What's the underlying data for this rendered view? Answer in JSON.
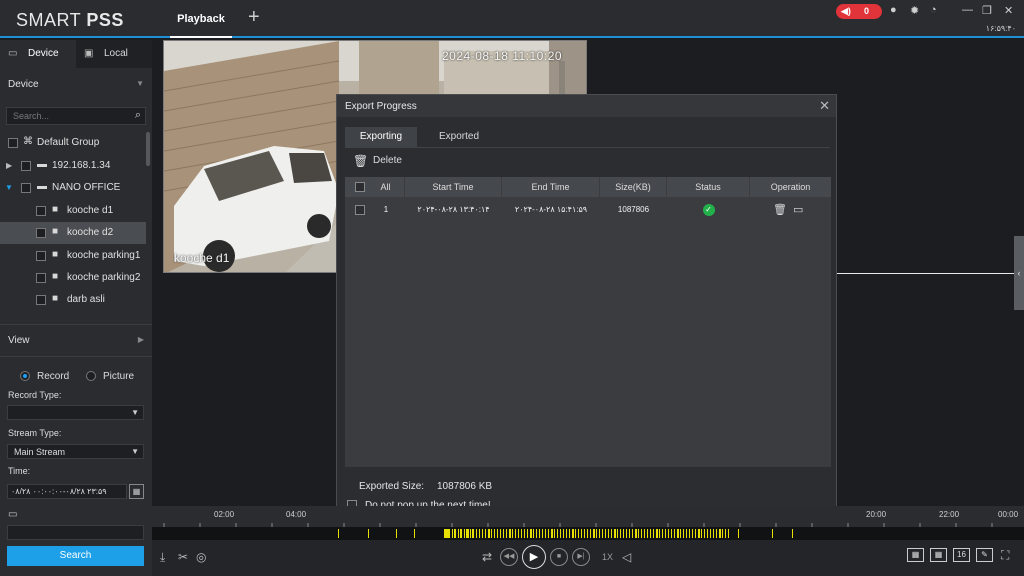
{
  "app": {
    "logo_light": "SMART ",
    "logo_bold": "PSS",
    "active_tab": "Playback",
    "add_tab": "+"
  },
  "titlebar": {
    "alarm_count": "0",
    "clock": "۱۶:۵۹:۴۰"
  },
  "left": {
    "tab_device": "Device",
    "tab_local": "Local",
    "device_section": "Device",
    "search_placeholder": "Search...",
    "tree": [
      {
        "label": "Default Group"
      },
      {
        "label": "192.168.1.34"
      },
      {
        "label": "NANO OFFICE"
      },
      {
        "label": "kooche d1"
      },
      {
        "label": "kooche d2"
      },
      {
        "label": "kooche parking1"
      },
      {
        "label": "kooche parking2"
      },
      {
        "label": "darb asli"
      }
    ],
    "view_section": "View",
    "radio_record": "Record",
    "radio_picture": "Picture",
    "record_type_label": "Record Type:",
    "record_type_value": "",
    "stream_type_label": "Stream Type:",
    "stream_type_value": "Main Stream",
    "time_label": "Time:",
    "time_value": "۰۸/۲۸ ۰۰:۰۰:۰۰-۰۸/۲۸ ۲۳:۵۹",
    "search_button": "Search"
  },
  "video": {
    "osd_time": "2024-08-18 11:10:20",
    "osd_name": "kooche d1"
  },
  "dialog": {
    "title": "Export Progress",
    "tab_exporting": "Exporting",
    "tab_exported": "Exported",
    "delete_label": "Delete",
    "columns": [
      "All",
      "Start Time",
      "End Time",
      "Size(KB)",
      "Status",
      "Operation"
    ],
    "rows": [
      {
        "index": "1",
        "start": "۲۰۲۴-۰۸-۲۸ ۱۳:۴۰:۱۴",
        "end": "۲۰۲۴-۰۸-۲۸ ۱۵:۴۱:۵۹",
        "size": "1087806"
      }
    ],
    "exported_size_label": "Exported Size:",
    "exported_size_value": "1087806 KB",
    "dont_pop_label": "Do not pop up the next time!"
  },
  "timeline": {
    "labels": [
      "02:00",
      "04:00",
      "20:00",
      "22:00",
      "00:00"
    ]
  },
  "bottombar": {
    "speed": "1X",
    "layout_16": "16"
  },
  "colors": {
    "accent": "#1ea0e8",
    "alarm": "#e0333a",
    "record_bar": "#e8e000",
    "status_ok": "#22b04a"
  }
}
